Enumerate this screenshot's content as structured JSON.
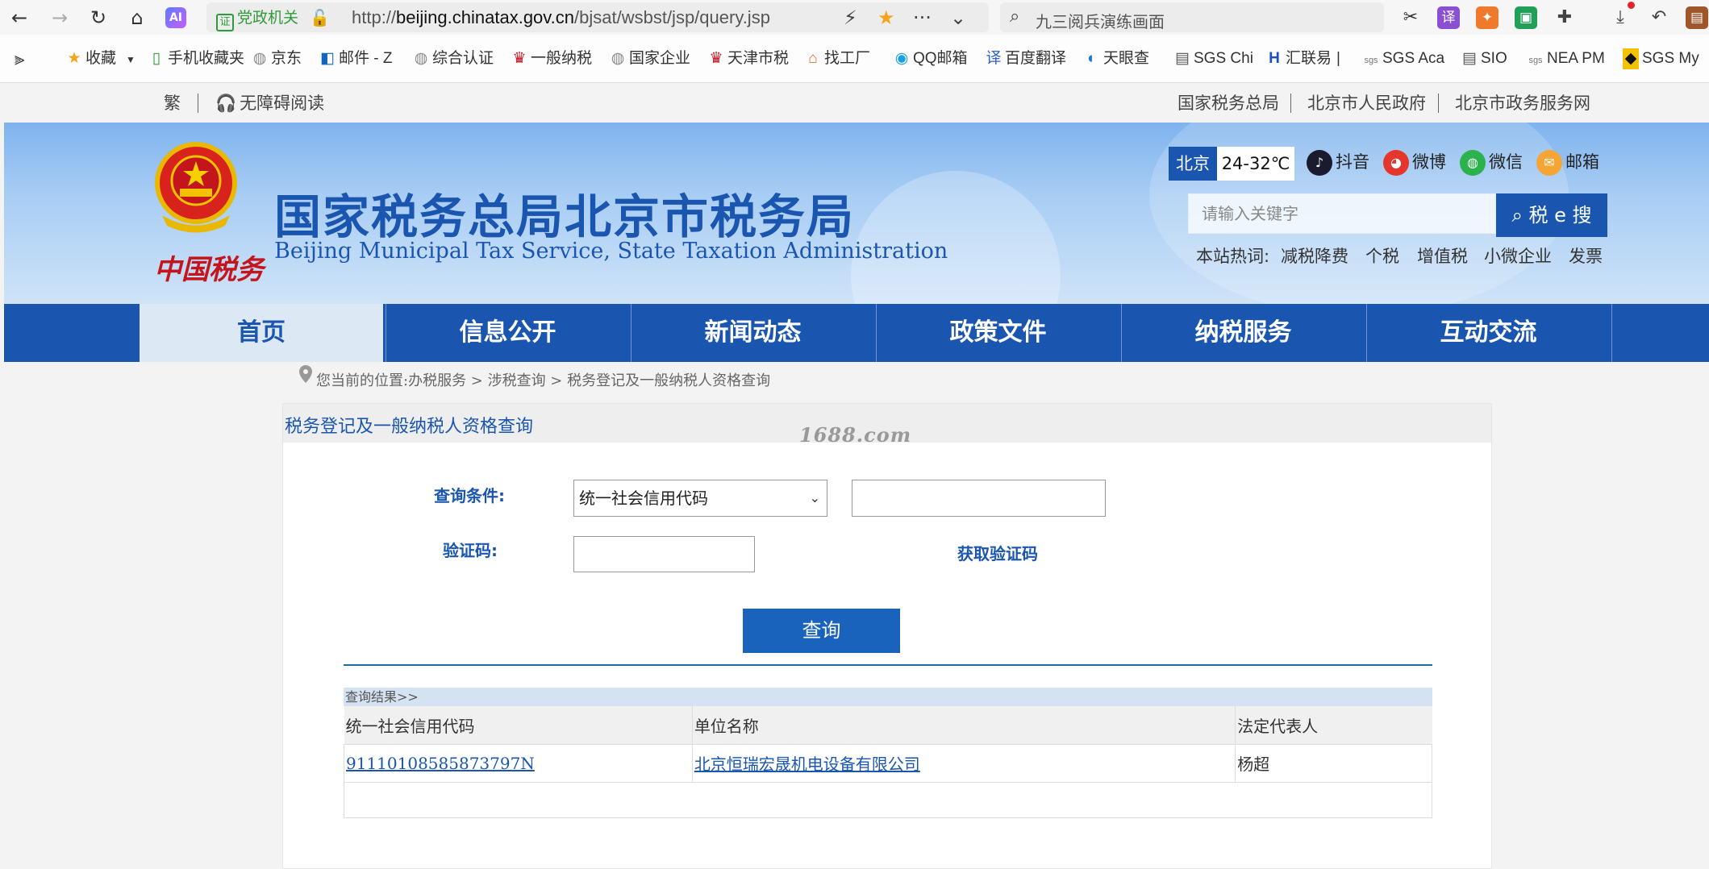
{
  "browser": {
    "party_badge": "党政机关",
    "url_prefix": "http://",
    "url_domain": "beijing.chinatax.gov.cn",
    "url_path": "/bjsat/wsbst/jsp/query.jsp",
    "search_text": "九三阅兵演练画面",
    "ai_label": "AI"
  },
  "bookmarks": [
    {
      "label": "收藏",
      "icon": "star-icon"
    },
    {
      "label": "手机收藏夹",
      "icon": "phone-icon"
    },
    {
      "label": "京东",
      "icon": "globe-icon"
    },
    {
      "label": "邮件 - Z",
      "icon": "outlook-icon"
    },
    {
      "label": "综合认证",
      "icon": "globe-icon"
    },
    {
      "label": "一般纳税",
      "icon": "emblem-icon"
    },
    {
      "label": "国家企业",
      "icon": "globe-icon"
    },
    {
      "label": "天津市税",
      "icon": "emblem-icon"
    },
    {
      "label": "找工厂",
      "icon": "factory-icon"
    },
    {
      "label": "QQ邮箱",
      "icon": "qq-icon"
    },
    {
      "label": "百度翻译",
      "icon": "translate-icon"
    },
    {
      "label": "天眼查",
      "icon": "tianyan-icon"
    },
    {
      "label": "SGS Chi",
      "icon": "doc-icon"
    },
    {
      "label": "汇联易",
      "icon": "h-icon"
    },
    {
      "label": "SGS Aca",
      "icon": "sgs-icon"
    },
    {
      "label": "SIO",
      "icon": "doc-icon"
    },
    {
      "label": "NEA PM",
      "icon": "sgs-icon"
    },
    {
      "label": "SGS My",
      "icon": "sgs-dark-icon"
    }
  ],
  "toplinks": {
    "traditional": "繁",
    "accessibility": "无障碍阅读",
    "right": [
      "国家税务总局",
      "北京市人民政府",
      "北京市政务服务网"
    ]
  },
  "banner": {
    "logo_script": "中国税务",
    "title": "国家税务总局北京市税务局",
    "subtitle": "Beijing Municipal Tax Service, State Taxation Administration",
    "weather_city": "北京",
    "weather_temp": "24-32℃",
    "social": [
      "抖音",
      "微博",
      "微信",
      "邮箱"
    ],
    "search_placeholder": "请输入关键字",
    "search_button": "税 e 搜",
    "hot_label": "本站热词:",
    "hot_words": [
      "减税降费",
      "个税",
      "增值税",
      "小微企业",
      "发票"
    ]
  },
  "nav": [
    "首页",
    "信息公开",
    "新闻动态",
    "政策文件",
    "纳税服务",
    "互动交流"
  ],
  "breadcrumb": "您当前的位置:办税服务 > 涉税查询 > 税务登记及一般纳税人资格查询",
  "panel": {
    "title": "税务登记及一般纳税人资格查询",
    "watermark": "1688.com",
    "condition_label": "查询条件:",
    "condition_selected": "统一社会信用代码",
    "captcha_label": "验证码:",
    "get_captcha": "获取验证码",
    "query_button": "查询"
  },
  "results": {
    "header": "查询结果>>",
    "columns": [
      "统一社会信用代码",
      "单位名称",
      "法定代表人"
    ],
    "rows": [
      [
        "91110108585873797N",
        "北京恒瑞宏晟机电设备有限公司",
        "杨超"
      ]
    ]
  },
  "colors": {
    "brand_blue": "#1a56b0",
    "seal_red": "#c4151c"
  }
}
